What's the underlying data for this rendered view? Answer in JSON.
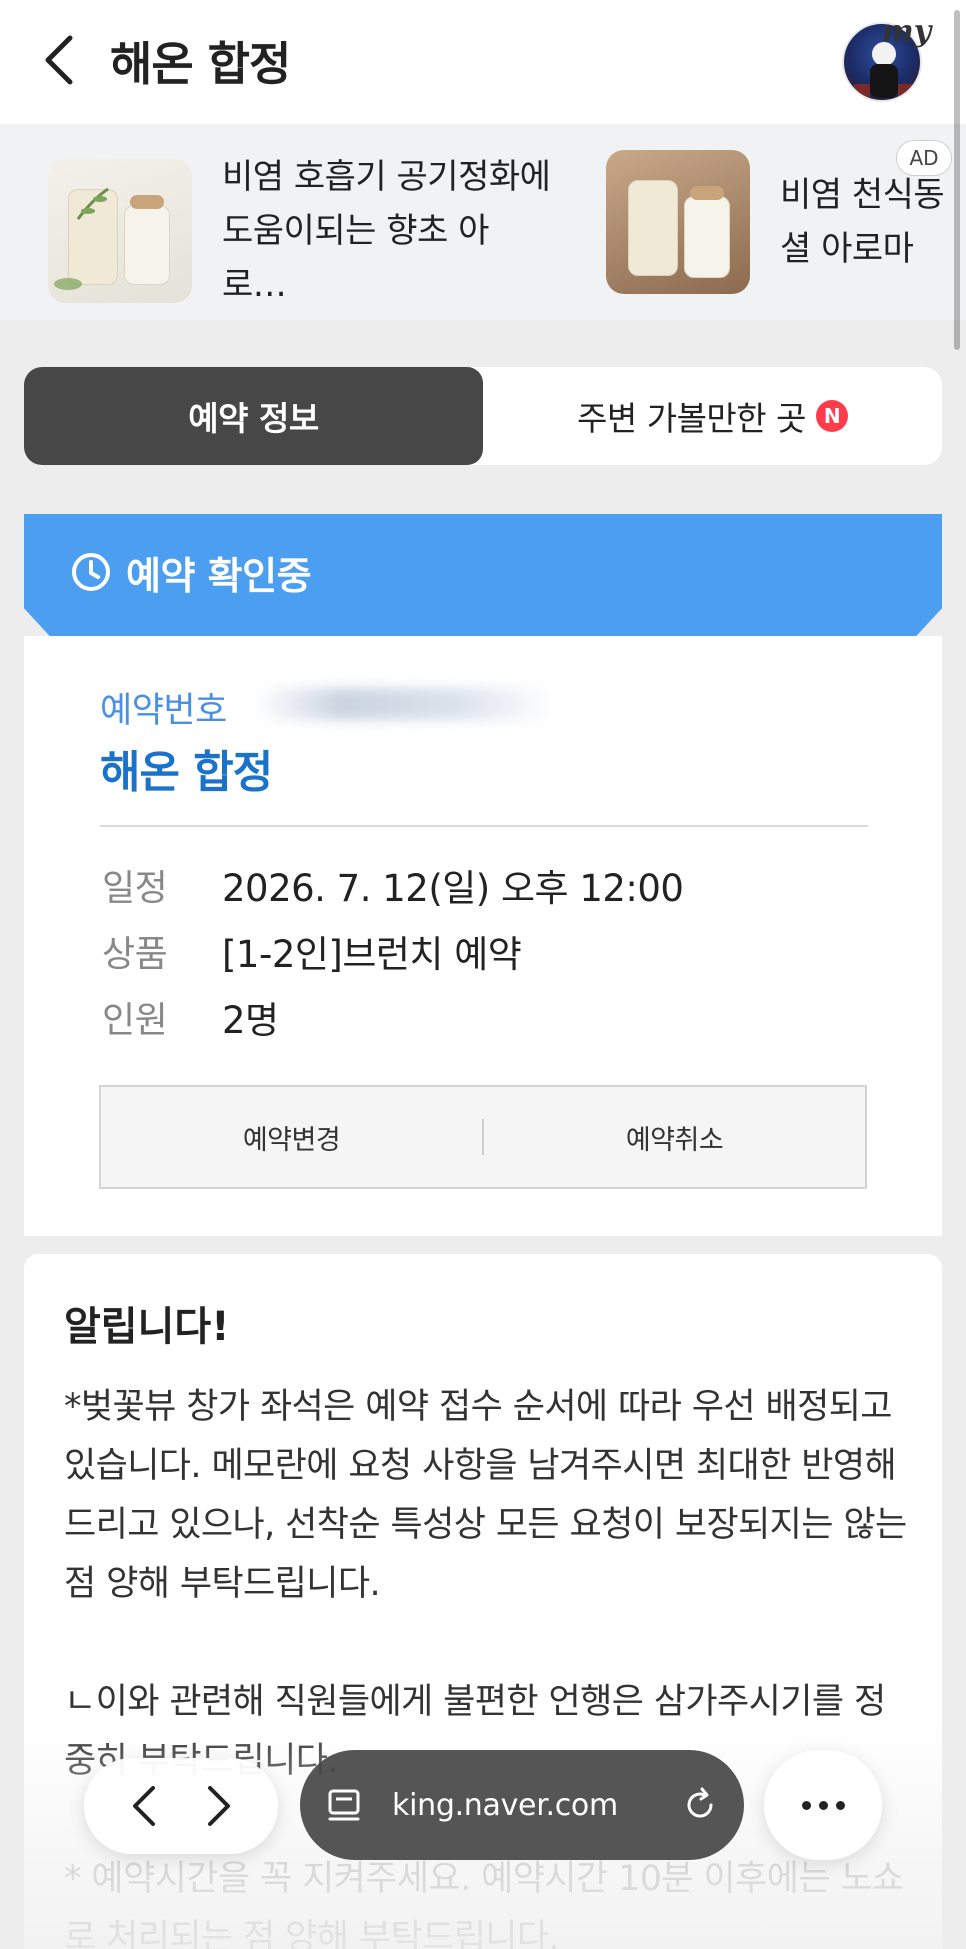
{
  "header": {
    "title": "해온 합정",
    "avatar_badge": "my"
  },
  "ads": {
    "badge": "AD",
    "items": [
      {
        "text": "비염 호흡기 공기정화에 도움이되는 향초 아로…"
      },
      {
        "text": "비염 천식동 셜 아로마"
      }
    ]
  },
  "tabs": [
    {
      "label": "예약 정보",
      "active": true
    },
    {
      "label": "주변 가볼만한 곳",
      "badge": "N",
      "active": false
    }
  ],
  "status": {
    "text": "예약 확인중",
    "color": "#4b9ef0"
  },
  "reservation": {
    "number_label": "예약번호",
    "store_name": "해온 합정",
    "rows": [
      {
        "key": "일정",
        "value": "2026. 7. 12(일) 오후 12:00"
      },
      {
        "key": "상품",
        "value": "[1-2인]브런치 예약"
      },
      {
        "key": "인원",
        "value": "2명"
      }
    ],
    "buttons": {
      "change": "예약변경",
      "cancel": "예약취소"
    }
  },
  "notice": {
    "title": "알립니다!",
    "body": "*벚꽃뷰 창가 좌석은 예약 접수 순서에 따라 우선 배정되고 있습니다. 메모란에 요청 사항을 남겨주시면 최대한 반영해드리고 있으나, 선착순 특성상 모든 요청이 보장되지는 않는 점 양해 부탁드립니다.\n\nㄴ이와 관련해 직원들에게 불편한 언행은 삼가주시기를 정중히 부탁드립니다.\n\n* 예약시간을 꼭 지켜주세요. 예약시간 10분 이후에는 노쇼로 처리되는 점 양해 부탁드립니다."
  },
  "browser": {
    "url": "king.naver.com"
  }
}
